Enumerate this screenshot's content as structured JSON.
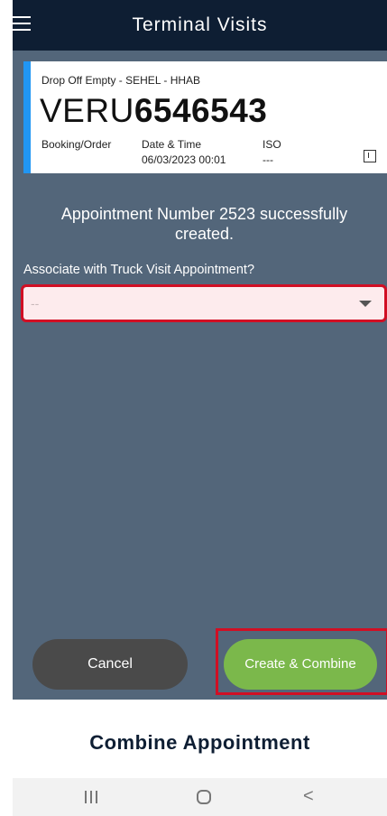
{
  "header": {
    "title": "Terminal Visits"
  },
  "card": {
    "type_line": "Drop Off Empty - SEHEL - HHAB",
    "container_prefix": "VERU",
    "container_number": "6546543",
    "fields": {
      "booking_label": "Booking/Order",
      "booking_value": "",
      "datetime_label": "Date & Time",
      "datetime_value": "06/03/2023 00:01",
      "iso_label": "ISO",
      "iso_value": "---"
    }
  },
  "message": "Appointment Number 2523 successfully created.",
  "associate": {
    "label": "Associate with Truck Visit Appointment?",
    "selected_value": "--"
  },
  "buttons": {
    "cancel_label": "Cancel",
    "create_label": "Create & Combine"
  },
  "sheet": {
    "title": "Combine Appointment"
  },
  "navbar": {
    "back_glyph": "<"
  },
  "colors": {
    "header_bg": "#0e1e33",
    "content_bg": "#53667a",
    "card_accent": "#2196f3",
    "cancel_bg": "#4a4a4a",
    "create_bg": "#7bb84b",
    "highlight": "#d10f24",
    "select_bg": "#fdebed"
  }
}
